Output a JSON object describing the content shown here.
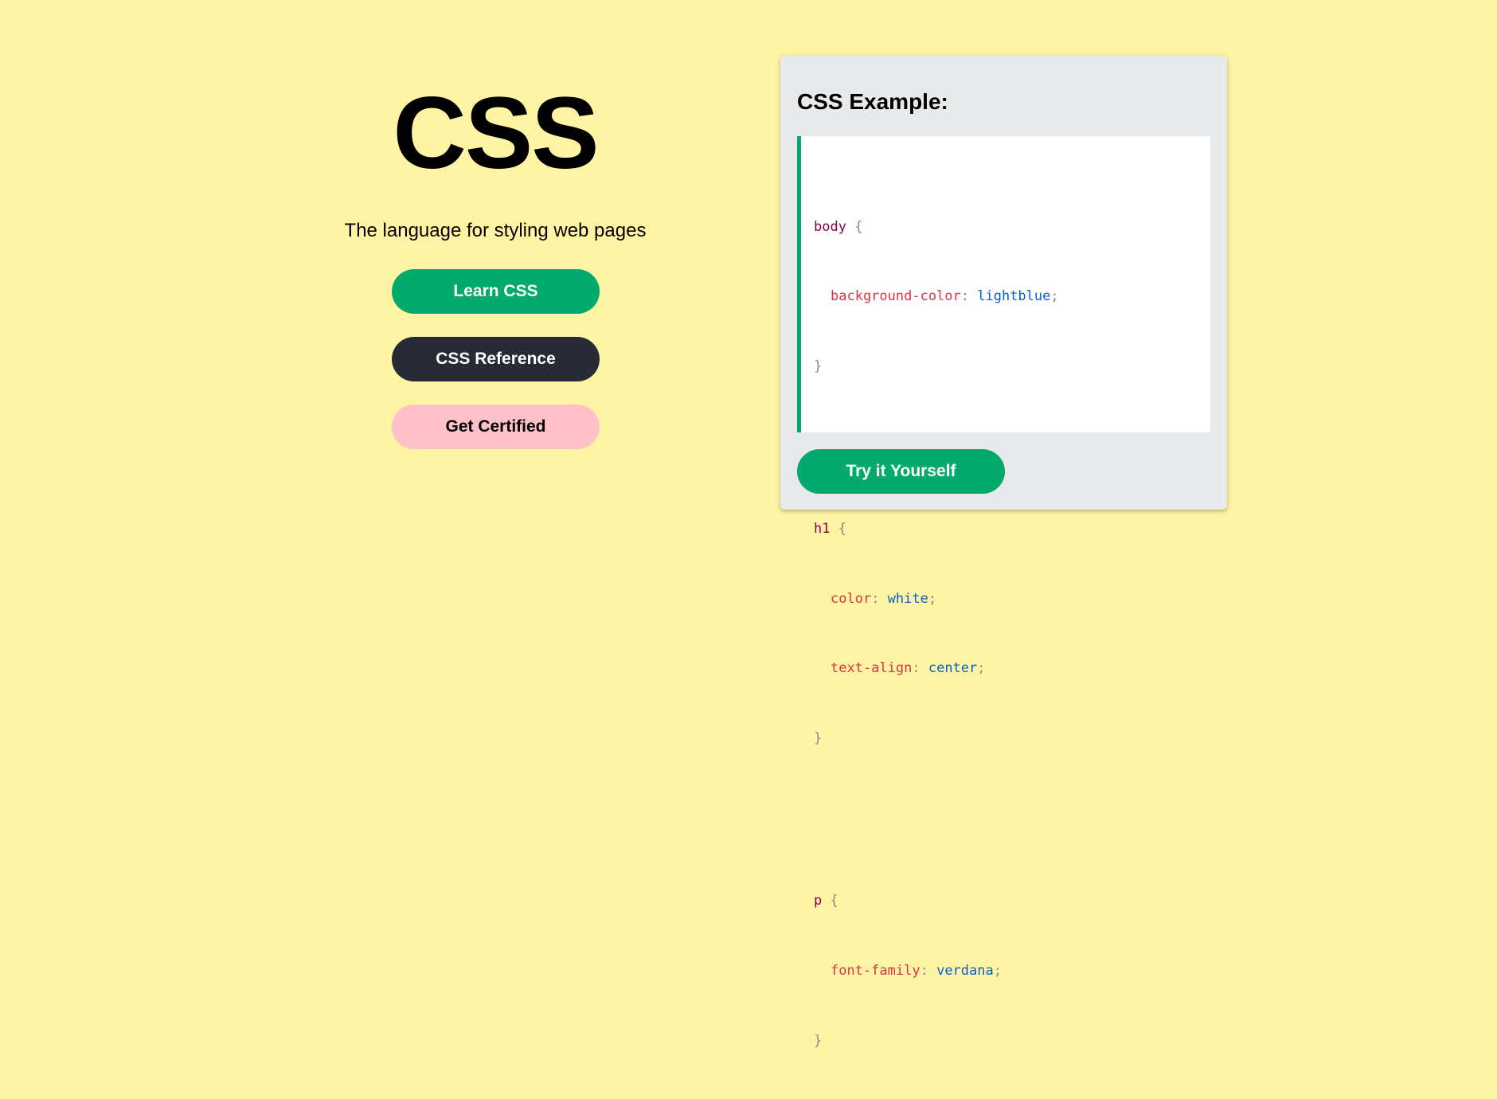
{
  "hero": {
    "title": "CSS",
    "tagline": "The language for styling web pages",
    "buttons": {
      "learn": "Learn CSS",
      "reference": "CSS Reference",
      "certified": "Get Certified"
    }
  },
  "example": {
    "title": "CSS Example:",
    "code": [
      {
        "selector": "body",
        "open": "{",
        "rules": [
          {
            "prop": "background-color",
            "value": "lightblue"
          }
        ],
        "close": "}"
      },
      {
        "selector": "h1",
        "open": "{",
        "rules": [
          {
            "prop": "color",
            "value": "white"
          },
          {
            "prop": "text-align",
            "value": "center"
          }
        ],
        "close": "}"
      },
      {
        "selector": "p",
        "open": "{",
        "rules": [
          {
            "prop": "font-family",
            "value": "verdana"
          }
        ],
        "close": "}"
      }
    ],
    "try_button": "Try it Yourself"
  },
  "colors": {
    "background": "#fff4a3",
    "accent_green": "#04aa6d",
    "dark_button": "#282a35",
    "pink_button": "#ffc0c7",
    "card_background": "#e7e9eb",
    "selector_color": "#8b0057",
    "property_color": "#dc3545",
    "value_color": "#0b5fc7"
  }
}
